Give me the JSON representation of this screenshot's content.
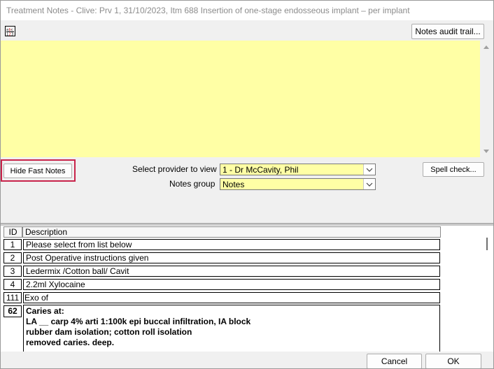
{
  "window": {
    "title": "Treatment Notes - Clive: Prv 1, 31/10/2023, Itm 688 Insertion of one-stage endosseous implant – per implant"
  },
  "toolbar": {
    "spellcheck_icon": "abc-spellcheck-icon",
    "audit_trail_label": "Notes audit trail..."
  },
  "notes": {
    "text": "",
    "background": "#ffffa5"
  },
  "controls": {
    "hide_fast_notes_label": "Hide Fast Notes",
    "highlight_color": "#c8234a",
    "provider_label": "Select provider to view",
    "provider_value": "1 - Dr McCavity, Phil",
    "notes_group_label": "Notes group",
    "notes_group_value": "Notes",
    "spell_check_label": "Spell check..."
  },
  "fast_notes": {
    "columns": [
      "ID",
      "Description"
    ],
    "rows": [
      {
        "id": "1",
        "description": "Please select from list below"
      },
      {
        "id": "2",
        "description": "Post Operative instructions given"
      },
      {
        "id": "3",
        "description": "Ledermix /Cotton ball/ Cavit"
      },
      {
        "id": "4",
        "description": "2.2ml Xylocaine"
      },
      {
        "id": "111",
        "description": "Exo of"
      },
      {
        "id": "62",
        "description_lines": [
          "Caries at:",
          "LA __ carp 4% arti 1:100k epi buccal infiltration, IA block",
          "rubber dam isolation; cotton roll isolation",
          "removed caries.  deep."
        ]
      }
    ]
  },
  "footer": {
    "cancel_label": "Cancel",
    "ok_label": "OK"
  }
}
